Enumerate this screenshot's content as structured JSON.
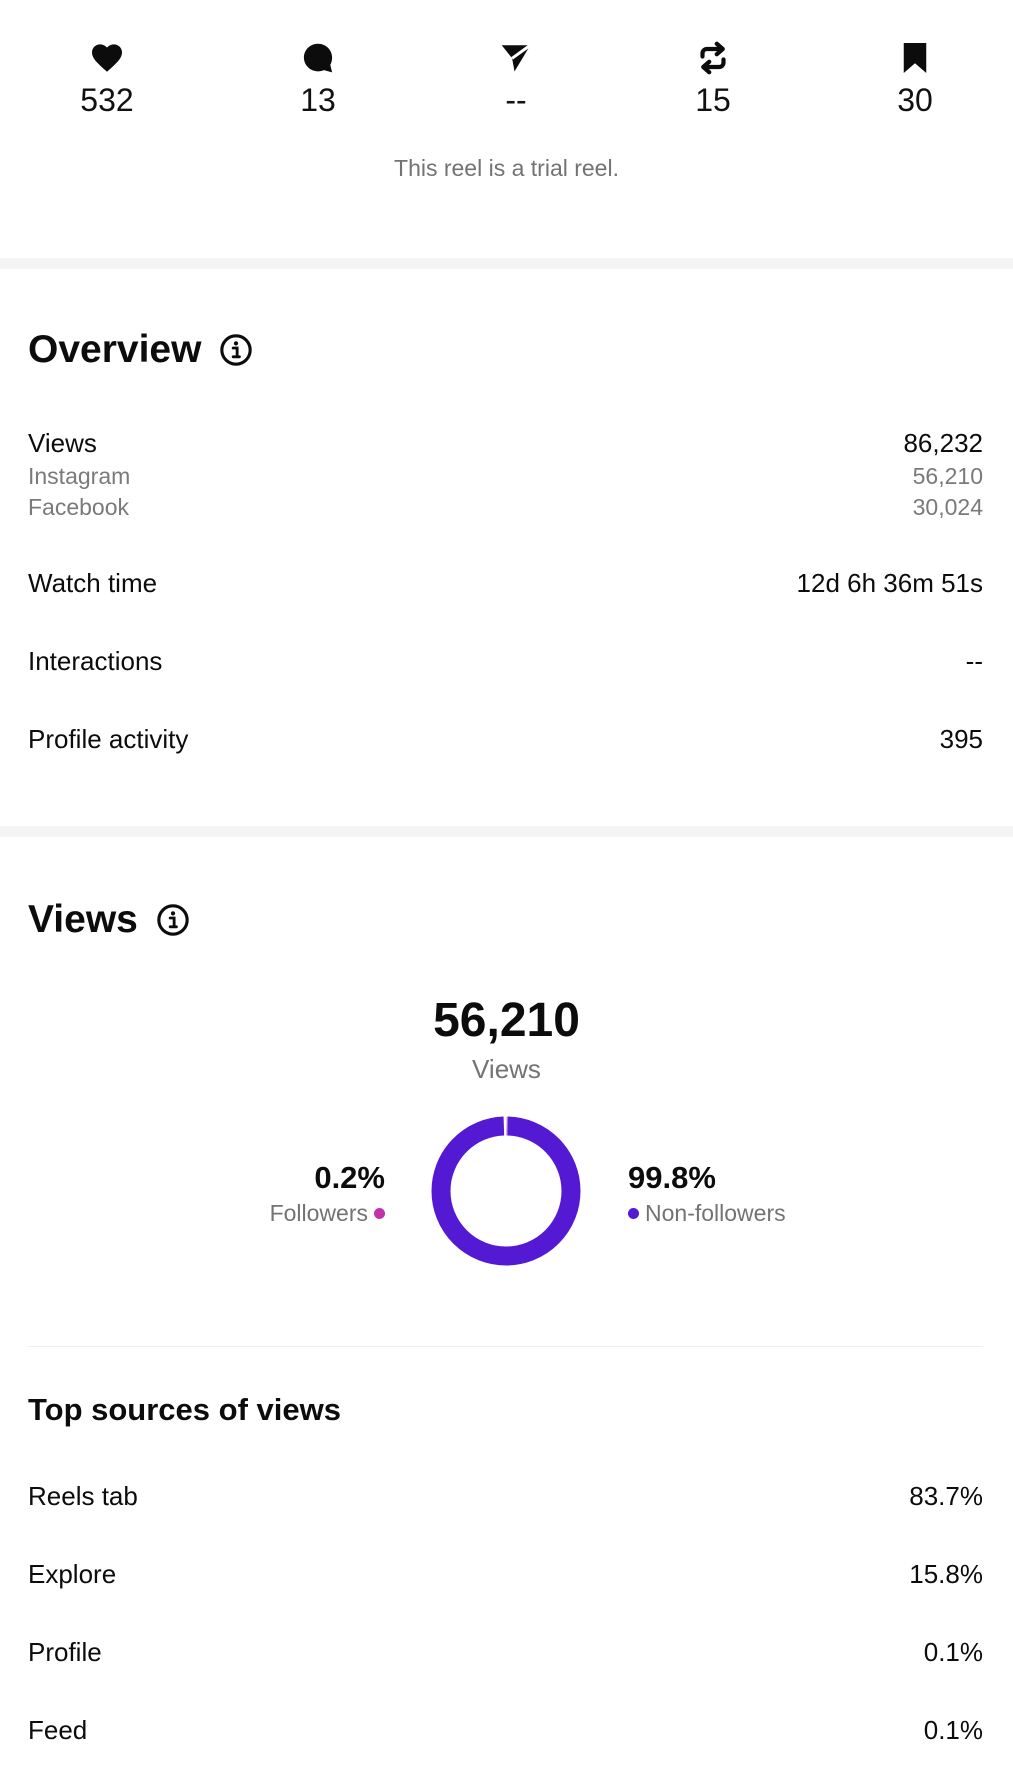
{
  "stats": {
    "likes": "532",
    "comments": "13",
    "shares": "--",
    "reposts": "15",
    "saves": "30",
    "icons": [
      "heart-icon",
      "comment-icon",
      "send-icon",
      "repost-icon",
      "bookmark-icon"
    ]
  },
  "trial_note": "This reel is a trial reel.",
  "overview": {
    "title": "Overview",
    "views_label": "Views",
    "views_value": "86,232",
    "instagram_label": "Instagram",
    "instagram_value": "56,210",
    "facebook_label": "Facebook",
    "facebook_value": "30,024",
    "watch_time_label": "Watch time",
    "watch_time_value": "12d 6h 36m 51s",
    "interactions_label": "Interactions",
    "interactions_value": "--",
    "profile_activity_label": "Profile activity",
    "profile_activity_value": "395"
  },
  "views": {
    "title": "Views",
    "total": "56,210",
    "total_label": "Views",
    "followers_pct": "0.2%",
    "followers_label": "Followers",
    "non_followers_pct": "99.8%",
    "non_followers_label": "Non-followers",
    "followers_fraction": 0.002,
    "non_followers_fraction": 0.998,
    "followers_color": "#c233a8",
    "non_followers_color": "#5319d3"
  },
  "top_sources": {
    "title": "Top sources of views",
    "items": [
      {
        "label": "Reels tab",
        "value": "83.7%"
      },
      {
        "label": "Explore",
        "value": "15.8%"
      },
      {
        "label": "Profile",
        "value": "0.1%"
      },
      {
        "label": "Feed",
        "value": "0.1%"
      }
    ]
  }
}
